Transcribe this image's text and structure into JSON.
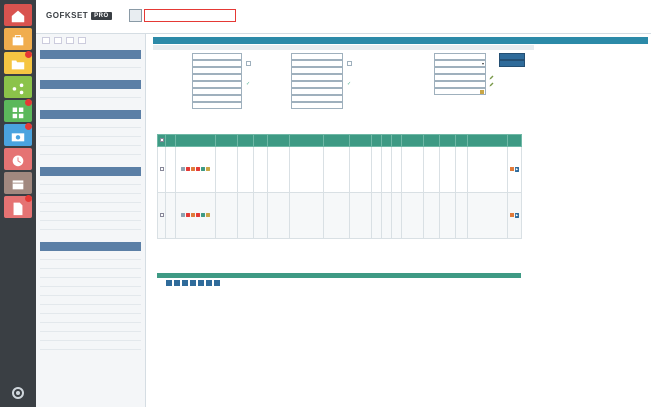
{
  "colors": {
    "rail": "#3a3f44",
    "header_accent": "#2c8aa8",
    "section_head": "#5b7fa6",
    "table_head": "#3e9a84",
    "button": "#2f6b9a",
    "alert_red": "#e53935"
  },
  "rail": {
    "icons": [
      {
        "name": "home-icon",
        "color": "#d9534f",
        "badge": false
      },
      {
        "name": "briefcase-icon",
        "color": "#f0ad4e",
        "badge": false
      },
      {
        "name": "folder-icon",
        "color": "#f5c542",
        "badge": true
      },
      {
        "name": "share-icon",
        "color": "#8bc34a",
        "badge": false
      },
      {
        "name": "grid-icon",
        "color": "#5cb85c",
        "badge": true
      },
      {
        "name": "camera-icon",
        "color": "#4aa3df",
        "badge": true
      },
      {
        "name": "clock-icon",
        "color": "#e57373",
        "badge": false
      },
      {
        "name": "box-icon",
        "color": "#a1887f",
        "badge": false
      },
      {
        "name": "document-icon",
        "color": "#e57373",
        "badge": true
      }
    ],
    "bottom_icon": "gear-icon"
  },
  "header": {
    "logo": "GOFKSET",
    "logo_badge": "PRO",
    "search_value": ""
  },
  "sidebar": {
    "mini_tabs": [
      "",
      "",
      "",
      ""
    ],
    "sections": [
      {
        "title": "",
        "items": [
          ""
        ]
      },
      {
        "title": "",
        "items": [
          ""
        ]
      },
      {
        "title": "",
        "items": [
          "",
          "",
          "",
          ""
        ]
      },
      {
        "title": "",
        "items": [
          "",
          "",
          "",
          "",
          "",
          ""
        ]
      },
      {
        "title": "",
        "items": [
          "",
          "",
          "",
          "",
          "",
          "",
          "",
          "",
          "",
          "",
          ""
        ]
      }
    ]
  },
  "main": {
    "title": "",
    "panel_title": "",
    "form": {
      "left_labels": [
        "",
        "",
        "",
        "",
        "",
        "",
        "",
        ""
      ],
      "mid_labels": [
        "",
        "",
        "",
        "",
        "",
        "",
        "",
        ""
      ],
      "right_labels": [
        "",
        "",
        "",
        "",
        "",
        ""
      ],
      "select_value": "",
      "buttons": [
        "",
        ""
      ]
    },
    "results_label": "",
    "table": {
      "headers": [
        "",
        "",
        "",
        "",
        "",
        "",
        "",
        "",
        "",
        "",
        "",
        "",
        "",
        "",
        "",
        "",
        "",
        "",
        ""
      ],
      "rows": [
        {
          "c3": "",
          "c5": "",
          "c6": "",
          "c7": "",
          "c8": "",
          "c9": "",
          "c13": "",
          "c14": "",
          "c15": "",
          "c16": ""
        },
        {
          "c3": "",
          "c5": "",
          "c6": "",
          "c7": "",
          "c8": "",
          "c9": "",
          "c13": "",
          "c14": "",
          "c15": "",
          "c16": ""
        }
      ],
      "footer": ""
    },
    "pager": [
      "",
      "",
      "",
      "",
      "",
      "",
      ""
    ]
  }
}
